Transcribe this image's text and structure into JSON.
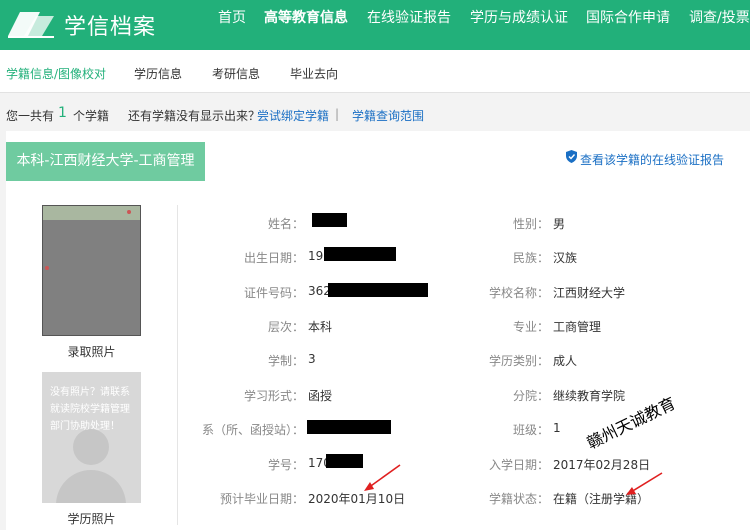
{
  "brand": {
    "name": "学信档案"
  },
  "nav": [
    {
      "label": "首页"
    },
    {
      "label": "高等教育信息"
    },
    {
      "label": "在线验证报告"
    },
    {
      "label": "学历与成绩认证"
    },
    {
      "label": "国际合作申请"
    },
    {
      "label": "调查/投票"
    }
  ],
  "subnav": [
    {
      "label": "学籍信息/图像校对"
    },
    {
      "label": "学历信息"
    },
    {
      "label": "考研信息"
    },
    {
      "label": "毕业去向"
    }
  ],
  "infobar": {
    "prefix": "您一共有",
    "count": "1",
    "suffix": "个学籍",
    "question": "还有学籍没有显示出来？",
    "bind_link": "尝试绑定学籍",
    "separator": "|",
    "range_link": "学籍查询范围"
  },
  "record": {
    "title": "本科-江西财经大学-工商管理",
    "verify_link": "查看该学籍的在线验证报告",
    "photo_label": "录取照片",
    "no_photo_msg": "没有照片？请联系就读院校学籍管理部门协助处理！",
    "edu_photo_label": "学历照片",
    "left_fields": [
      {
        "label": "姓名：",
        "value": ""
      },
      {
        "label": "出生日期：",
        "value": "19"
      },
      {
        "label": "证件号码：",
        "value": "362"
      },
      {
        "label": "层次：",
        "value": "本科"
      },
      {
        "label": "学制：",
        "value": "3"
      },
      {
        "label": "学习形式：",
        "value": "函授"
      },
      {
        "label": "系（所、函授站）：",
        "value": ""
      },
      {
        "label": "学号：",
        "value": "170"
      },
      {
        "label": "预计毕业日期：",
        "value": "2020年01月10日"
      }
    ],
    "right_fields": [
      {
        "label": "性别：",
        "value": "男"
      },
      {
        "label": "民族：",
        "value": "汉族"
      },
      {
        "label": "学校名称：",
        "value": "江西财经大学"
      },
      {
        "label": "专业：",
        "value": "工商管理"
      },
      {
        "label": "学历类别：",
        "value": "成人"
      },
      {
        "label": "分院：",
        "value": "继续教育学院"
      },
      {
        "label": "班级：",
        "value": "1"
      },
      {
        "label": "入学日期：",
        "value": "2017年02月28日"
      },
      {
        "label": "学籍状态：",
        "value": "在籍（注册学籍）"
      }
    ]
  },
  "watermark": "赣州天诚教育",
  "colors": {
    "primary": "#22b07a",
    "tab": "#6fcba0",
    "link": "#1a6fc4",
    "arrow": "#e02020"
  },
  "icons": [
    "logo-icon",
    "shield-icon",
    "avatar-icon",
    "arrow-icon"
  ]
}
